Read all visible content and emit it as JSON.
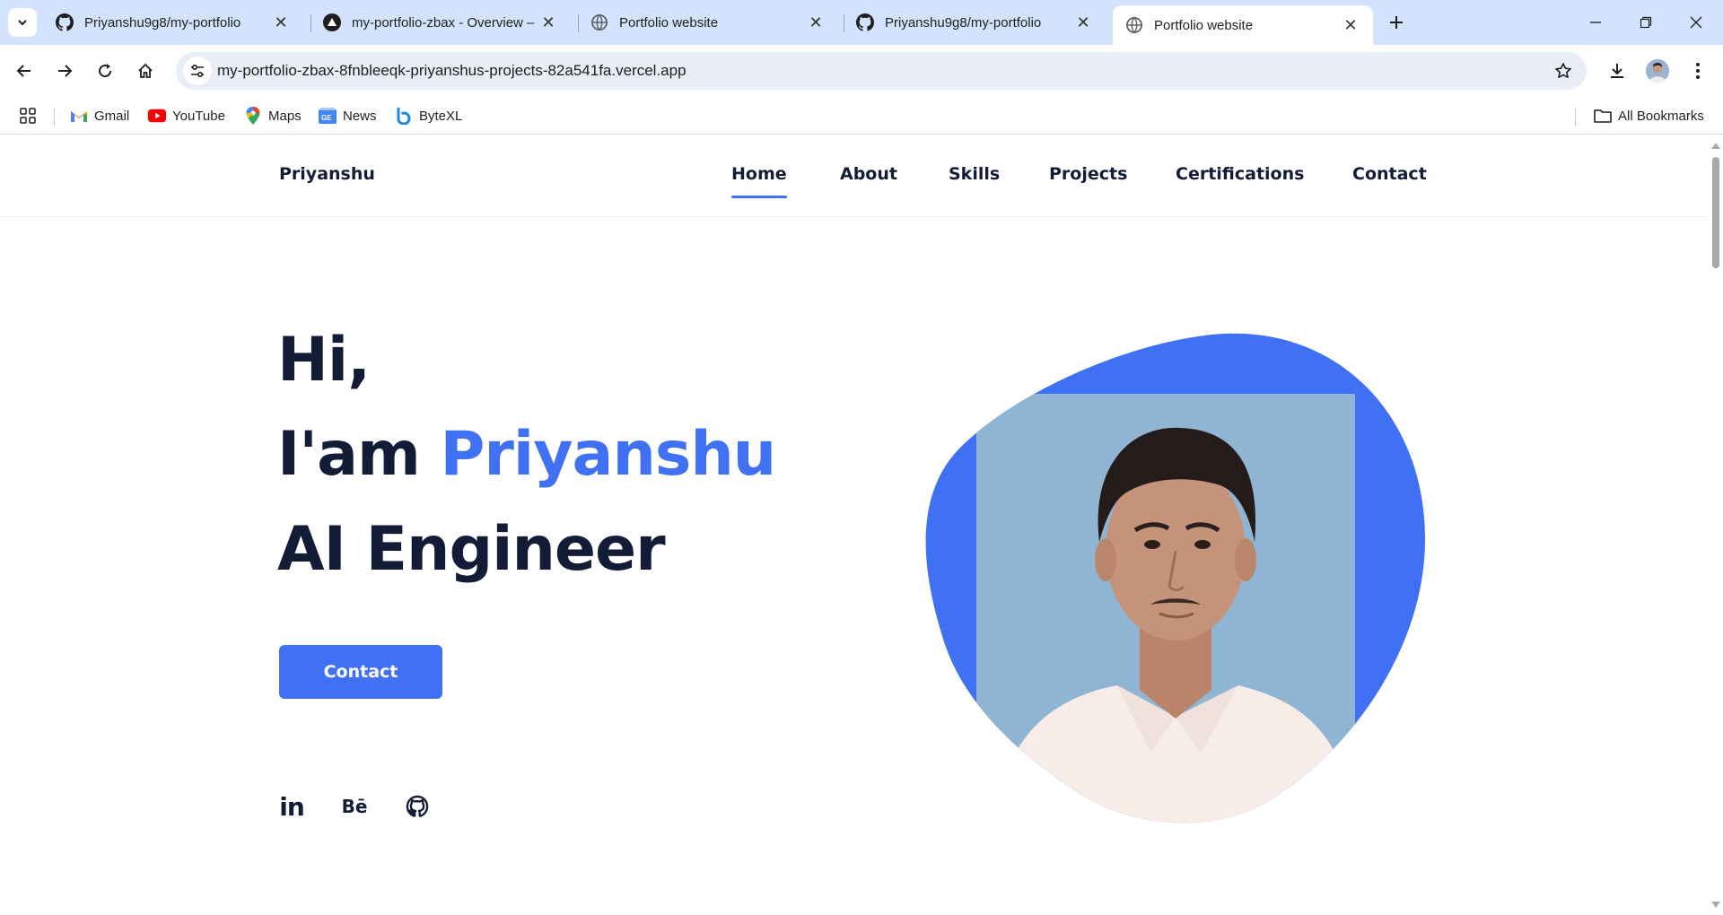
{
  "browser": {
    "tabs": [
      {
        "title": "Priyanshu9g8/my-portfolio",
        "icon": "github-icon",
        "active": false
      },
      {
        "title": "my-portfolio-zbax - Overview –",
        "icon": "vercel-icon",
        "active": false
      },
      {
        "title": "Portfolio website",
        "icon": "globe-icon",
        "active": false
      },
      {
        "title": "Priyanshu9g8/my-portfolio",
        "icon": "github-icon",
        "active": false
      },
      {
        "title": "Portfolio website",
        "icon": "globe-icon",
        "active": true
      }
    ],
    "url": "my-portfolio-zbax-8fnbleeqk-priyanshus-projects-82a541fa.vercel.app",
    "bookmarks": [
      {
        "label": "Gmail",
        "icon": "gmail-icon"
      },
      {
        "label": "YouTube",
        "icon": "youtube-icon"
      },
      {
        "label": "Maps",
        "icon": "maps-icon"
      },
      {
        "label": "News",
        "icon": "news-icon"
      },
      {
        "label": "ByteXL",
        "icon": "bytexl-icon"
      }
    ],
    "all_bookmarks_label": "All Bookmarks",
    "colors": {
      "tabbar": "#d3e3fd",
      "omnibox": "#e9eef6"
    }
  },
  "site": {
    "brand": "Priyanshu",
    "nav": [
      {
        "label": "Home",
        "active": true
      },
      {
        "label": "About",
        "active": false
      },
      {
        "label": "Skills",
        "active": false
      },
      {
        "label": "Projects",
        "active": false
      },
      {
        "label": "Certifications",
        "active": false
      },
      {
        "label": "Contact",
        "active": false
      }
    ],
    "hero": {
      "line1": "Hi,",
      "line2_prefix": "I'am ",
      "line2_name": "Priyanshu",
      "line3": "AI Engineer",
      "cta_label": "Contact"
    },
    "social": [
      {
        "label": "in",
        "icon": "linkedin-icon"
      },
      {
        "label": "Bē",
        "icon": "behance-icon"
      },
      {
        "label": "",
        "icon": "github-icon"
      }
    ],
    "colors": {
      "accent": "#4070f4",
      "text": "#121c36",
      "photo_bg": "#8fb5d3"
    }
  }
}
